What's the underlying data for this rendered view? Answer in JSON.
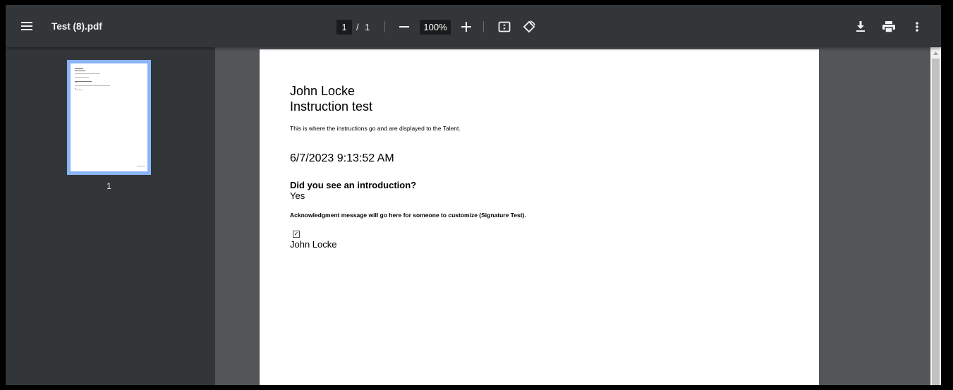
{
  "toolbar": {
    "menu_icon": "hamburger-menu-icon",
    "title": "Test (8).pdf",
    "page_current": "1",
    "page_separator": "/",
    "page_total": "1",
    "zoom_out_icon": "minus-icon",
    "zoom_level": "100%",
    "zoom_in_icon": "plus-icon",
    "fit_icon": "fit-to-page-icon",
    "rotate_icon": "rotate-counterclockwise-icon",
    "download_icon": "download-icon",
    "print_icon": "printer-icon",
    "more_icon": "more-vertical-icon"
  },
  "sidebar": {
    "thumbnails": [
      {
        "page_number": "1",
        "selected": true
      }
    ]
  },
  "document": {
    "name": "John Locke",
    "heading": "Instruction test",
    "instructions": "This is where the instructions go and are displayed to the Talent.",
    "datetime": "6/7/2023 9:13:52 AM",
    "question": "Did you see an introduction?",
    "answer": "Yes",
    "acknowledgment": "Acknowledgment message will go here for someone to customize (Signature Test).",
    "checkbox_mark": "✓",
    "checkbox_checked": true,
    "signature": "John Locke"
  },
  "colors": {
    "toolbar_bg": "#323639",
    "viewer_bg": "#525659",
    "thumbnail_selected_border": "#8ab4f8"
  }
}
